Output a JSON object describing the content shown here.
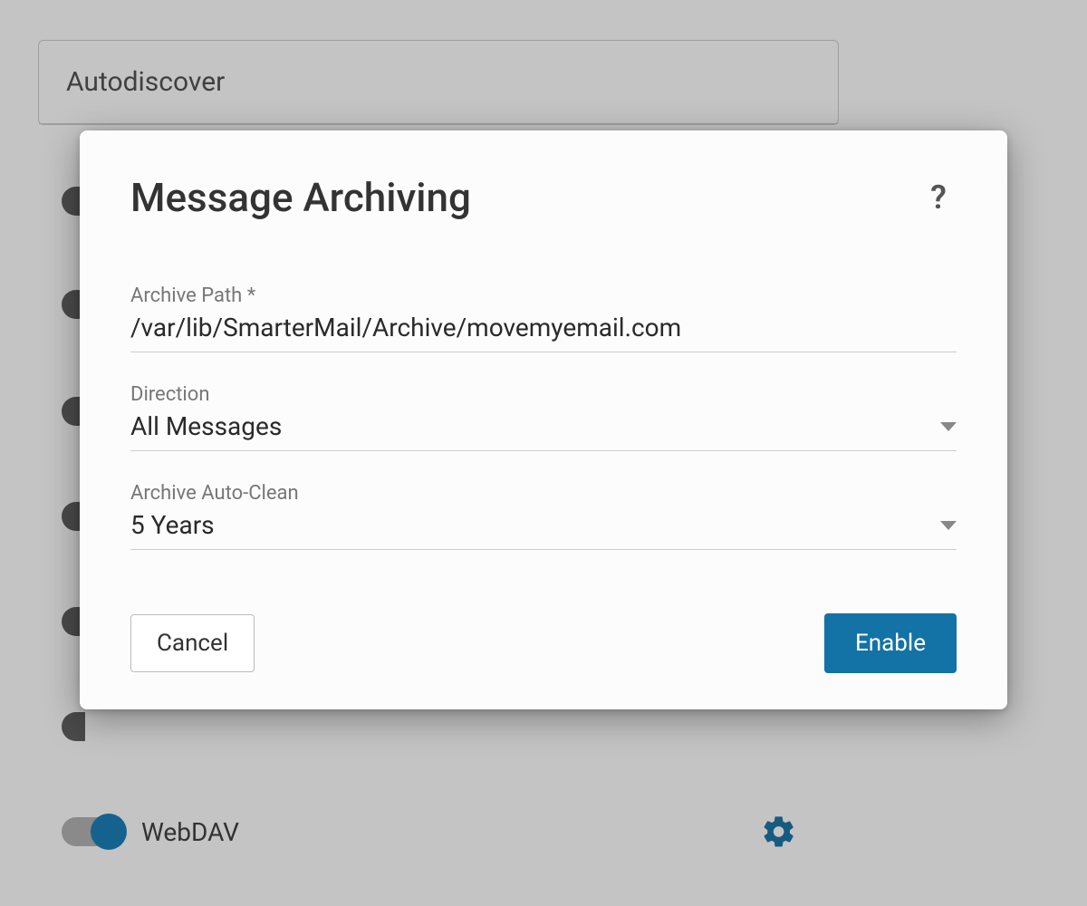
{
  "background": {
    "card_title": "Autodiscover",
    "webdav_label": "WebDAV"
  },
  "modal": {
    "title": "Message Archiving",
    "help_symbol": "?",
    "fields": {
      "archive_path": {
        "label": "Archive Path *",
        "value": "/var/lib/SmarterMail/Archive/movemyemail.com"
      },
      "direction": {
        "label": "Direction",
        "value": "All Messages"
      },
      "auto_clean": {
        "label": "Archive Auto-Clean",
        "value": "5 Years"
      }
    },
    "buttons": {
      "cancel": "Cancel",
      "enable": "Enable"
    }
  }
}
